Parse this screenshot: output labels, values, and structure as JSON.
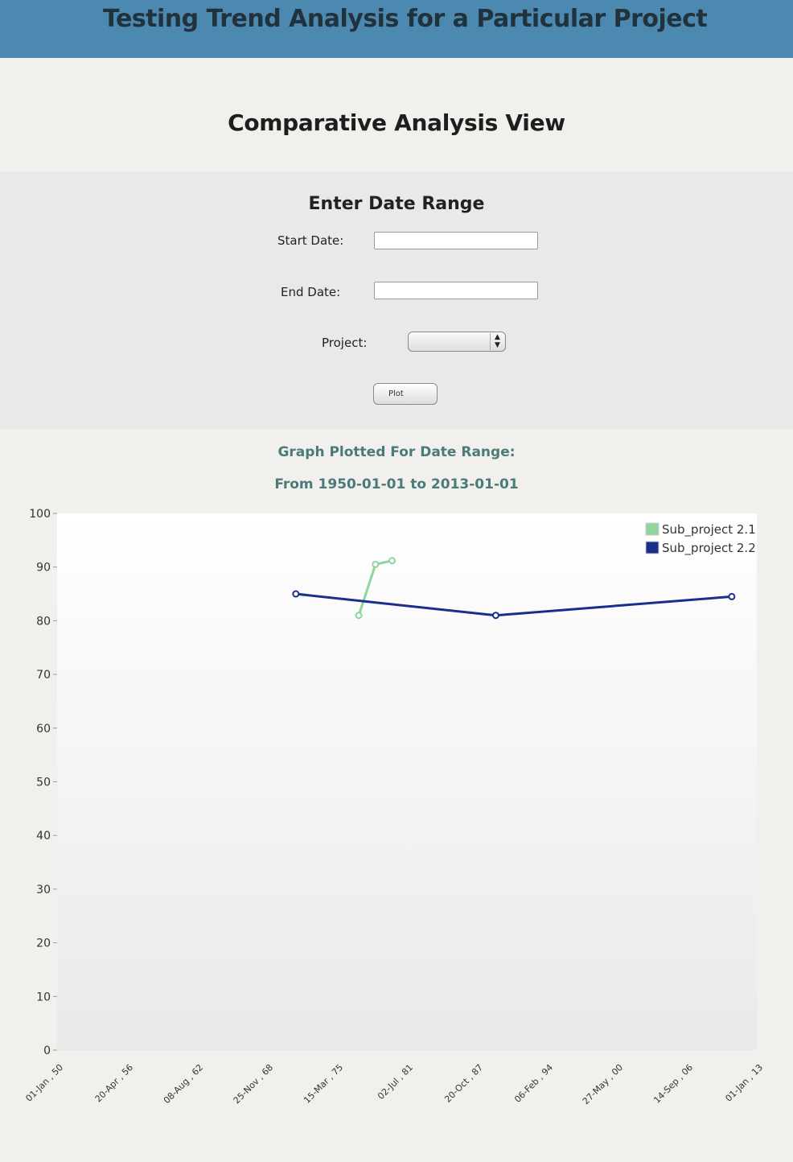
{
  "header": {
    "title": "Testing Trend Analysis for a Particular Project"
  },
  "view_title": "Comparative Analysis View",
  "form": {
    "title": "Enter Date Range",
    "start_label": "Start Date:",
    "start_value": "",
    "end_label": "End Date:",
    "end_value": "",
    "project_label": "Project:",
    "project_value": "",
    "plot_label": "Plot"
  },
  "graph": {
    "caption": "Graph Plotted For Date Range:",
    "range_text": "From 1950-01-01 to 2013-01-01"
  },
  "chart_data": {
    "type": "line",
    "title": "",
    "xlabel": "",
    "ylabel": "",
    "ylim": [
      0,
      100
    ],
    "yticks": [
      0,
      10,
      20,
      30,
      40,
      50,
      60,
      70,
      80,
      90,
      100
    ],
    "xlim": [
      "1950-01-01",
      "2013-01-01"
    ],
    "xtick_labels": [
      "01-Jan , 50",
      "20-Apr , 56",
      "08-Aug , 62",
      "25-Nov , 68",
      "15-Mar , 75",
      "02-Jul , 81",
      "20-Oct , 87",
      "06-Feb , 94",
      "27-May , 00",
      "14-Sep , 06",
      "01-Jan , 13"
    ],
    "legend_position": "top-right",
    "grid": false,
    "series": [
      {
        "name": "Sub_project 2.1",
        "color": "#8fd5a0",
        "points": [
          {
            "x": "1977-03-01",
            "y": 81
          },
          {
            "x": "1978-09-01",
            "y": 90.5
          },
          {
            "x": "1980-03-01",
            "y": 91.2
          }
        ]
      },
      {
        "name": "Sub_project 2.2",
        "color": "#1a2e8c",
        "points": [
          {
            "x": "1971-07-01",
            "y": 85
          },
          {
            "x": "1989-07-01",
            "y": 81
          },
          {
            "x": "2010-10-01",
            "y": 84.5
          }
        ]
      }
    ]
  }
}
